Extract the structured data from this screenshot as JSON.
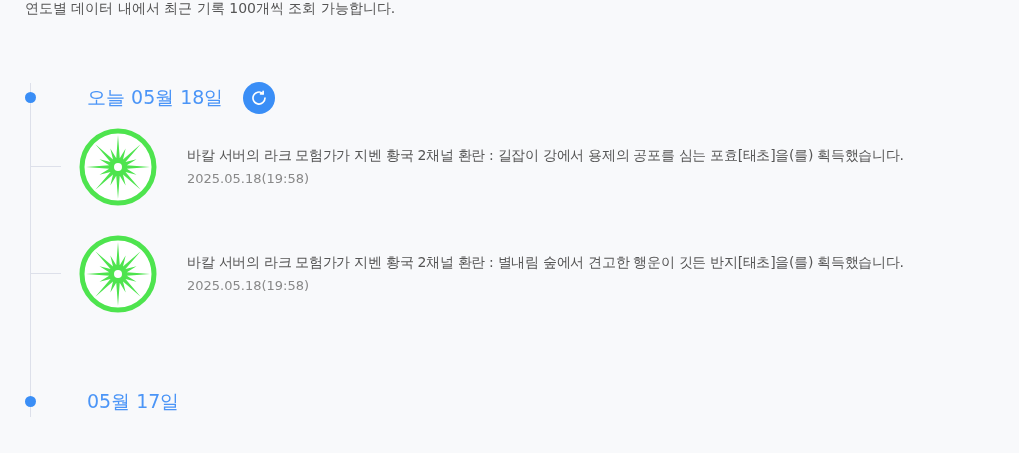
{
  "notice": "연도별 데이터 내에서 최근 기록 100개씩 조회 가능합니다.",
  "days": [
    {
      "date": "오늘 05월 18일",
      "refresh": true,
      "entries": [
        {
          "message": "바칼 서버의 라크 모험가가 지벤 황국 2채널 환란 : 길잡이 강에서 용제의 공포를 심는 포효[태초]을(를) 획득했습니다.",
          "time": "2025.05.18(19:58)"
        },
        {
          "message": "바칼 서버의 라크 모험가가 지벤 황국 2채널 환란 : 별내림 숲에서 견고한 행운이 깃든 반지[태초]을(를) 획득했습니다.",
          "time": "2025.05.18(19:58)"
        }
      ]
    },
    {
      "date": "05월 17일",
      "refresh": false
    }
  ]
}
